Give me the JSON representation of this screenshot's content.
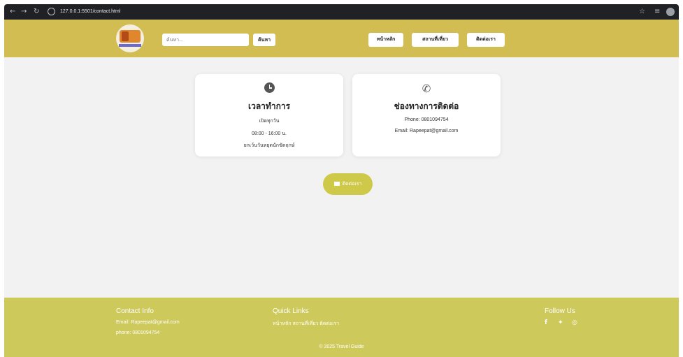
{
  "browser": {
    "url": "127.0.0.1:5501/contact.html"
  },
  "header": {
    "search_placeholder": "ค้นหา...",
    "search_button": "ค้นหา",
    "nav": [
      "หน้าหลัก",
      "สถานที่เที่ยว",
      "ติดต่อเรา"
    ]
  },
  "cards": {
    "hours": {
      "icon": "clock-icon",
      "title": "เวลาทำการ",
      "lines": [
        "เปิดทุกวัน",
        "08:00 - 16:00 น.",
        "ยกเว้นวันหยุดนักขัตฤกษ์"
      ]
    },
    "contact": {
      "icon": "phone-icon",
      "title": "ช่องทางการติดต่อ",
      "lines": [
        "Phone: 0801094754",
        "Email: Rapeepat@gmail.com"
      ]
    }
  },
  "contact_button": "ติดต่อเรา",
  "footer": {
    "contact_info": {
      "heading": "Contact Info",
      "email": "Email: Rapeepat@gmail.com",
      "phone": "phone: 0801094754"
    },
    "quick_links": {
      "heading": "Quick Links",
      "links": [
        "หน้าหลัก",
        "สถานที่เที่ยว",
        "ติดต่อเรา"
      ]
    },
    "follow": {
      "heading": "Follow Us",
      "icons": [
        "facebook-icon",
        "twitter-icon",
        "instagram-icon"
      ]
    },
    "copyright": "© 2025 Travel Guide"
  },
  "colors": {
    "header": "#d2bd53",
    "footer": "#cdc95b",
    "button": "#cfc94a",
    "main_bg": "#f2f2f2"
  }
}
